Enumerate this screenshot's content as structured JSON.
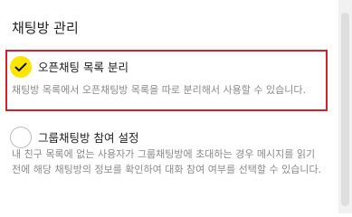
{
  "section": {
    "title": "채팅방 관리"
  },
  "options": [
    {
      "title": "오픈채팅 목록 분리",
      "description": "채팅방 목록에서 오픈채팅방 목록을 따로 분리해서 사용할 수 있습니다.",
      "checked": true
    },
    {
      "title": "그룹채팅방 참여 설정",
      "description": "내 친구 목록에 없는 사용자가 그룹채팅방에 초대하는 경우 메시지를 읽기 전에 해당 채팅방의 정보를 확인하여 대화 참여 여부를 선택할 수 있습니다.",
      "checked": false
    }
  ],
  "colors": {
    "check_fill": "#fee500",
    "highlight_border": "#d4212a"
  }
}
